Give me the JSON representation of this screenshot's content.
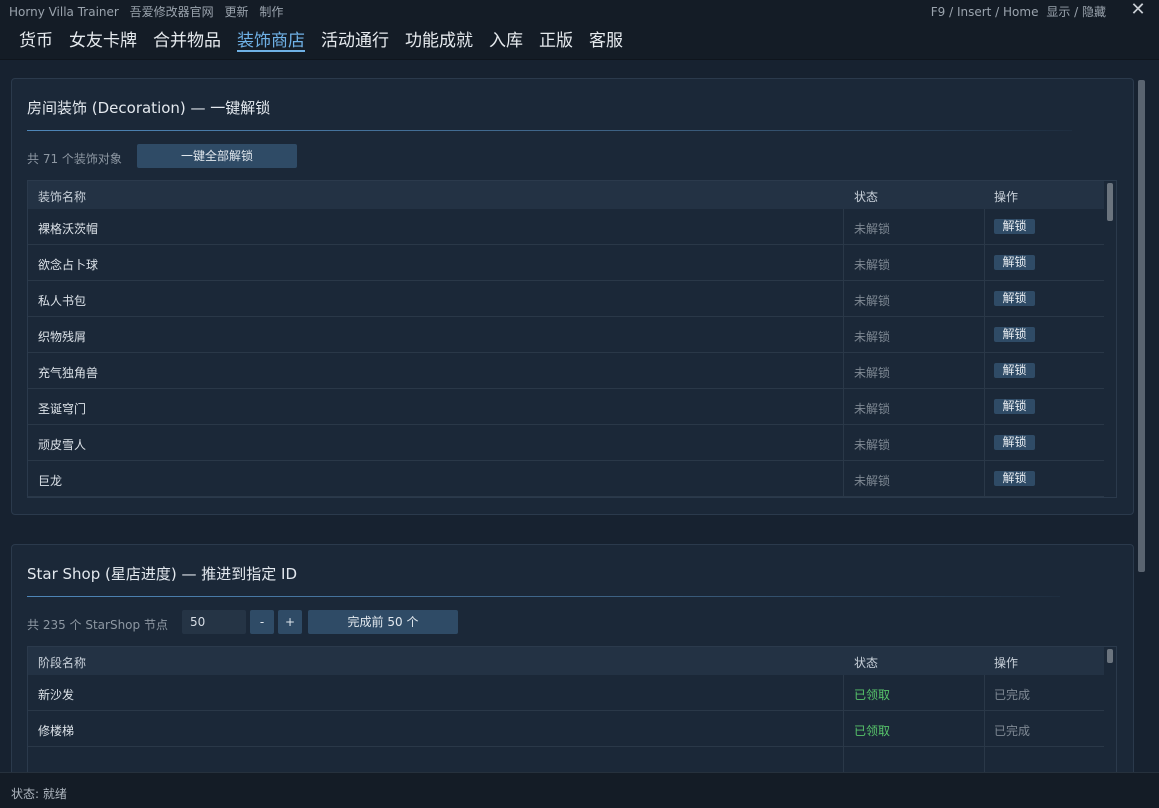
{
  "titlebar": {
    "app_name": "Horny Villa Trainer",
    "links": [
      "吾爱修改器官网",
      "更新",
      "制作"
    ],
    "hotkey_hint": "F9 / Insert / Home",
    "toggle_label": "显示 / 隐藏",
    "close_glyph": "✕"
  },
  "nav": {
    "tabs": [
      {
        "label": "货币"
      },
      {
        "label": "女友卡牌"
      },
      {
        "label": "合并物品"
      },
      {
        "label": "装饰商店",
        "active": true
      },
      {
        "label": "活动通行"
      },
      {
        "label": "功能成就"
      },
      {
        "label": "入库"
      },
      {
        "label": "正版"
      },
      {
        "label": "客服"
      }
    ]
  },
  "decoration": {
    "title": "房间装饰 (Decoration) — 一键解锁",
    "count_label": "共 71 个装饰对象",
    "unlock_all_label": "一键全部解锁",
    "columns": [
      "装饰名称",
      "状态",
      "操作"
    ],
    "action_label": "解锁",
    "rows": [
      {
        "name": "裸格沃茨帽",
        "status": "未解锁"
      },
      {
        "name": "欲念占卜球",
        "status": "未解锁"
      },
      {
        "name": "私人书包",
        "status": "未解锁"
      },
      {
        "name": "织物残屑",
        "status": "未解锁"
      },
      {
        "name": "充气独角兽",
        "status": "未解锁"
      },
      {
        "name": "圣诞穹门",
        "status": "未解锁"
      },
      {
        "name": "顽皮雪人",
        "status": "未解锁"
      },
      {
        "name": "巨龙",
        "status": "未解锁"
      }
    ]
  },
  "starshop": {
    "title": "Star Shop (星店进度) — 推进到指定 ID",
    "count_label": "共 235 个 StarShop 节点",
    "input_value": "50",
    "minus_label": "-",
    "plus_label": "+",
    "complete_label": "完成前 50 个",
    "columns": [
      "阶段名称",
      "状态",
      "操作"
    ],
    "rows": [
      {
        "name": "新沙发",
        "status": "已领取",
        "action": "已完成"
      },
      {
        "name": "修楼梯",
        "status": "已领取",
        "action": "已完成"
      }
    ]
  },
  "statusbar": {
    "text": "状态: 就绪"
  },
  "colors": {
    "accent": "#6fb1e6",
    "button": "#2f4b66",
    "claimed_green": "#57c46a",
    "background": "#141c26",
    "panel": "#1b2838"
  }
}
